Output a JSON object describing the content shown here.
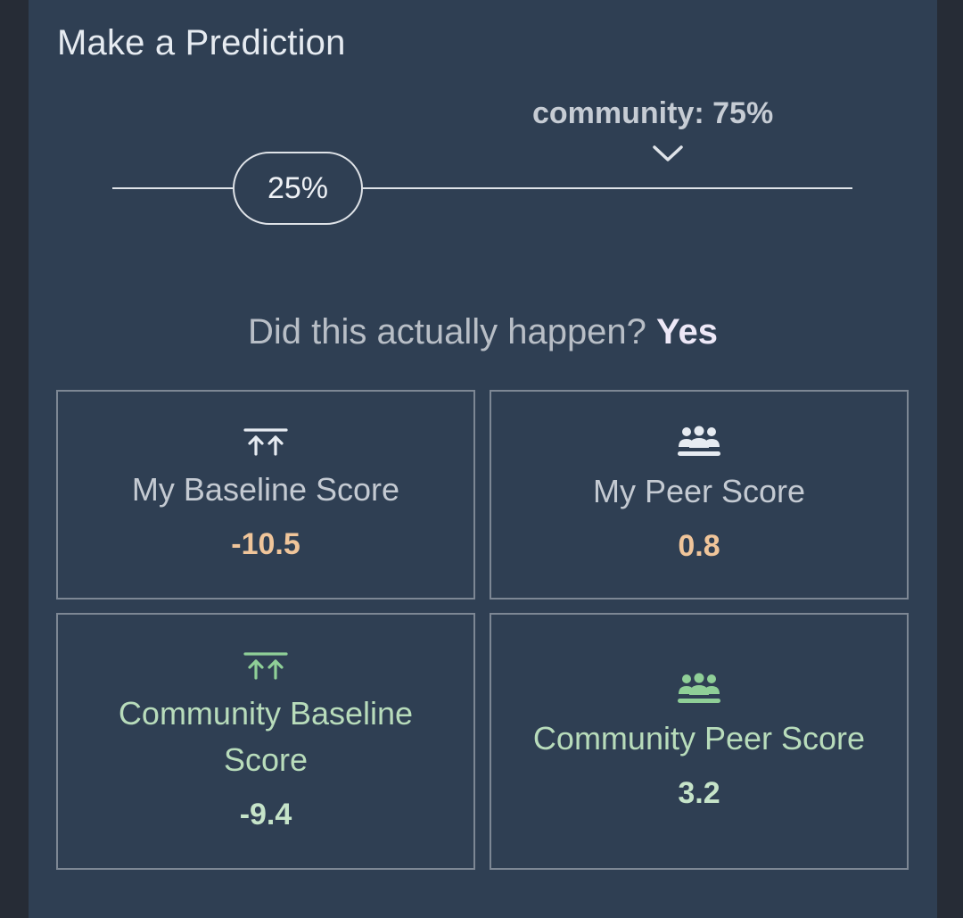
{
  "title": "Make a Prediction",
  "slider": {
    "community_label": "community: 75%",
    "community_value": 0.75,
    "user_value_label": "25%",
    "user_value": 0.25
  },
  "question": {
    "text": "Did this actually happen?",
    "answer": "Yes"
  },
  "scores": {
    "my_baseline": {
      "label": "My Baseline Score",
      "value": "-10.5",
      "icon": "baseline-arrows-icon"
    },
    "my_peer": {
      "label": "My Peer Score",
      "value": "0.8",
      "icon": "users-group-icon"
    },
    "community_baseline": {
      "label": "Community Baseline Score",
      "value": "-9.4",
      "icon": "baseline-arrows-icon"
    },
    "community_peer": {
      "label": "Community Peer Score",
      "value": "3.2",
      "icon": "users-group-icon"
    }
  },
  "colors": {
    "panel_bg": "#2f3f53",
    "my_value": "#f0c59a",
    "community_text": "#b8dcbb",
    "answer": "#ede8f7"
  }
}
